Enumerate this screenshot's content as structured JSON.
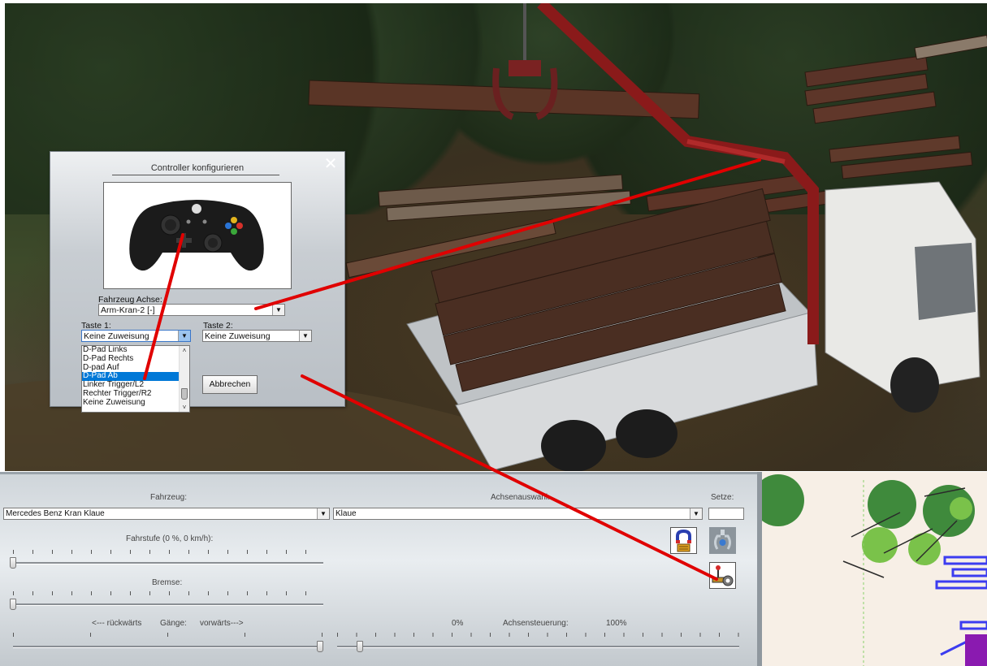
{
  "dialog": {
    "title": "Controller konfigurieren",
    "close_glyph": "✕",
    "axis_label": "Fahrzeug Achse:",
    "axis_value": "Arm-Kran-2 [-]",
    "key1_label": "Taste 1:",
    "key1_value": "Keine Zuweisung",
    "key2_label": "Taste 2:",
    "key2_value": "Keine Zuweisung",
    "cancel_label": "Abbrechen",
    "dropdown_items": [
      "D-Pad Links",
      "D-Pad Rechts",
      "D-pad Auf",
      "D-Pad Ab",
      "Linker Trigger/L2",
      "Rechter Trigger/R2",
      "Keine Zuweisung"
    ],
    "selected_index": 3
  },
  "panel": {
    "vehicle_label": "Fahrzeug:",
    "vehicle_value": "Mercedes Benz Kran Klaue",
    "axis_select_label": "Achsenauswahl:",
    "axis_select_value": "Klaue",
    "set_label": "Setze:",
    "set_value": "",
    "speed_label": "Fahrstufe (0 %, 0 km/h):",
    "speed_value": 0,
    "brake_label": "Bremse:",
    "brake_value": 0,
    "back_label": "<--- rückwärts",
    "gears_label": "Gänge:",
    "fwd_label": "vorwärts--->",
    "gear_position": 1.0,
    "axis_min_label": "0%",
    "axis_control_label": "Achsensteuerung:",
    "axis_max_label": "100%",
    "axis_control_value": 0.05
  },
  "colors": {
    "accent_selection": "#0078d7",
    "annotation_red": "#e00000"
  },
  "icons": {
    "magnet": "magnet-lock-icon",
    "claw": "claw-grip-icon",
    "controller_settings": "joystick-gear-icon"
  }
}
